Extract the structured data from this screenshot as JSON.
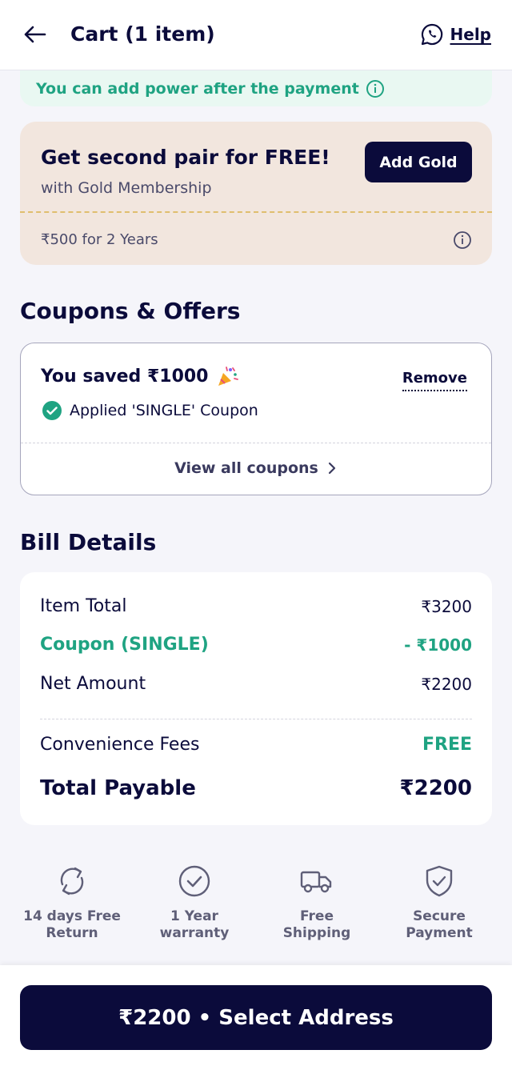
{
  "header": {
    "title": "Cart (1 item)",
    "help_label": "Help"
  },
  "power_banner": {
    "text": "You can add power after the payment"
  },
  "gold_card": {
    "title": "Get second pair for FREE!",
    "subtitle": "with Gold Membership",
    "button_label": "Add Gold",
    "price_text": "₹500 for 2 Years"
  },
  "coupons": {
    "section_title": "Coupons & Offers",
    "saved_text": "You saved ₹1000",
    "applied_text": "Applied 'SINGLE' Coupon",
    "remove_label": "Remove",
    "view_all_label": "View all coupons"
  },
  "bill": {
    "section_title": "Bill Details",
    "rows": [
      {
        "label": "Item Total",
        "value": "₹3200"
      },
      {
        "label": "Coupon (SINGLE)",
        "value": "- ₹1000"
      },
      {
        "label": "Net Amount",
        "value": "₹2200"
      },
      {
        "label": "Convenience Fees",
        "value": "FREE"
      },
      {
        "label": "Total Payable",
        "value": "₹2200"
      }
    ]
  },
  "features": [
    {
      "icon": "return-icon",
      "label_line1": "14 days Free",
      "label_line2": "Return"
    },
    {
      "icon": "warranty-check-icon",
      "label_line1": "1 Year",
      "label_line2": "warranty"
    },
    {
      "icon": "truck-icon",
      "label_line1": "Free",
      "label_line2": "Shipping"
    },
    {
      "icon": "shield-check-icon",
      "label_line1": "Secure",
      "label_line2": "Payment"
    }
  ],
  "cta": {
    "label": "₹2200 • Select Address"
  },
  "colors": {
    "primary": "#0B0B3B",
    "accent_green": "#1FA382",
    "gold_bg": "#F2E6DE",
    "page_bg": "#F5F5FA"
  }
}
